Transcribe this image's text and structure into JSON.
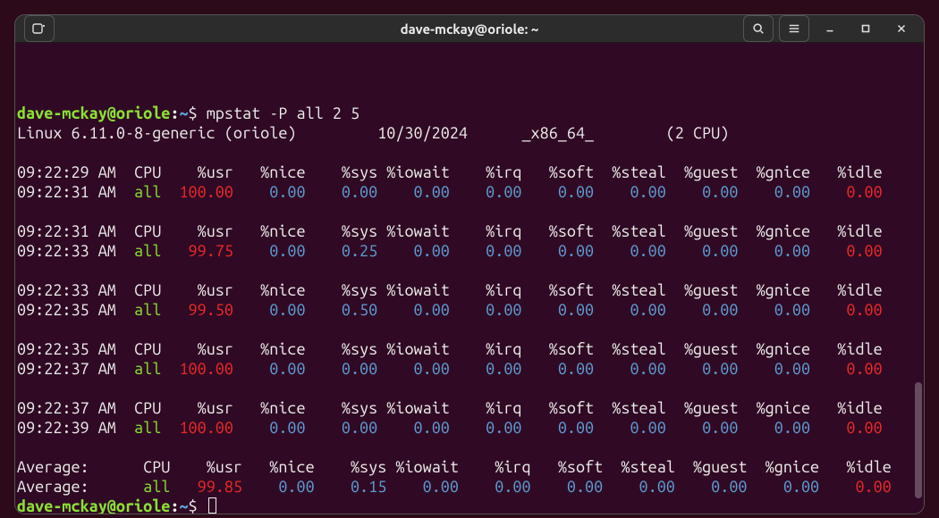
{
  "window": {
    "title": "dave-mckay@oriole: ~"
  },
  "prompt": {
    "user": "dave-mckay@oriole",
    "colon": ":",
    "path": "~",
    "symbol": "$",
    "command": "mpstat -P all 2 5"
  },
  "sys_info": "Linux 6.11.0-8-generic (oriole)         10/30/2024      _x86_64_        (2 CPU)",
  "columns": {
    "time": "            ",
    "cpu_h": "CPU",
    "usr": "%usr",
    "nice": "%nice",
    "sys": "%sys",
    "iowait": "%iowait",
    "irq": "%irq",
    "soft": "%soft",
    "steal": "%steal",
    "guest": "%guest",
    "gnice": "%gnice",
    "idle": "%idle"
  },
  "blocks": [
    {
      "hdr_time": "09:22:29 AM",
      "row_time": "09:22:31 AM",
      "cpu": "all",
      "usr": "100.00",
      "nice": "0.00",
      "sys": "0.00",
      "iowait": "0.00",
      "irq": "0.00",
      "soft": "0.00",
      "steal": "0.00",
      "guest": "0.00",
      "gnice": "0.00",
      "idle": "0.00"
    },
    {
      "hdr_time": "09:22:31 AM",
      "row_time": "09:22:33 AM",
      "cpu": "all",
      "usr": "99.75",
      "nice": "0.00",
      "sys": "0.25",
      "iowait": "0.00",
      "irq": "0.00",
      "soft": "0.00",
      "steal": "0.00",
      "guest": "0.00",
      "gnice": "0.00",
      "idle": "0.00"
    },
    {
      "hdr_time": "09:22:33 AM",
      "row_time": "09:22:35 AM",
      "cpu": "all",
      "usr": "99.50",
      "nice": "0.00",
      "sys": "0.50",
      "iowait": "0.00",
      "irq": "0.00",
      "soft": "0.00",
      "steal": "0.00",
      "guest": "0.00",
      "gnice": "0.00",
      "idle": "0.00"
    },
    {
      "hdr_time": "09:22:35 AM",
      "row_time": "09:22:37 AM",
      "cpu": "all",
      "usr": "100.00",
      "nice": "0.00",
      "sys": "0.00",
      "iowait": "0.00",
      "irq": "0.00",
      "soft": "0.00",
      "steal": "0.00",
      "guest": "0.00",
      "gnice": "0.00",
      "idle": "0.00"
    },
    {
      "hdr_time": "09:22:37 AM",
      "row_time": "09:22:39 AM",
      "cpu": "all",
      "usr": "100.00",
      "nice": "0.00",
      "sys": "0.00",
      "iowait": "0.00",
      "irq": "0.00",
      "soft": "0.00",
      "steal": "0.00",
      "guest": "0.00",
      "gnice": "0.00",
      "idle": "0.00"
    }
  ],
  "average": {
    "hdr_label": "Average:    ",
    "row_label": "Average:    ",
    "cpu": "all",
    "usr": "99.85",
    "nice": "0.00",
    "sys": "0.15",
    "iowait": "0.00",
    "irq": "0.00",
    "soft": "0.00",
    "steal": "0.00",
    "guest": "0.00",
    "gnice": "0.00",
    "idle": "0.00"
  }
}
